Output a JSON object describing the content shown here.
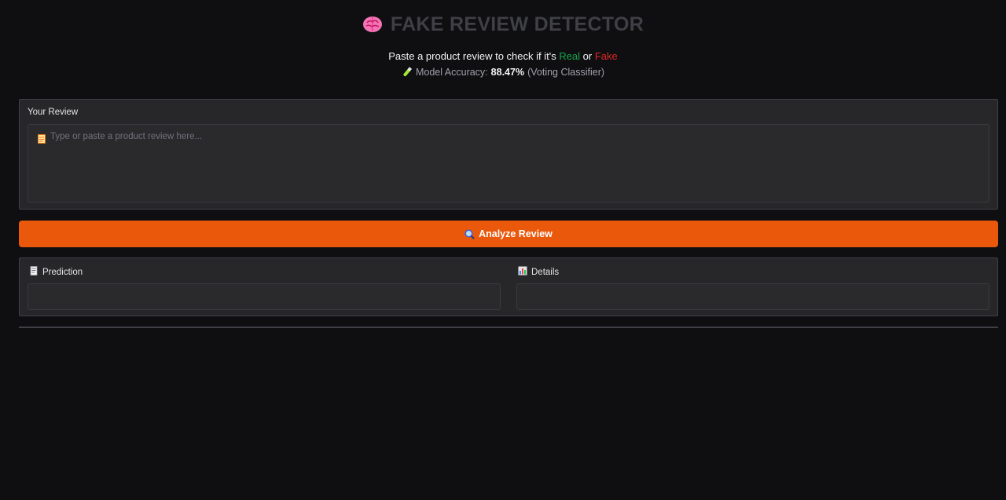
{
  "header": {
    "title": "FAKE REVIEW DETECTOR",
    "icon": "brain-icon",
    "subtitle_prefix": "Paste a product review to check if it's ",
    "real_word": "Real",
    "or_word": " or ",
    "fake_word": "Fake",
    "accuracy_label": "Model Accuracy:",
    "accuracy_value": "88.47%",
    "accuracy_note": "(Voting Classifier)",
    "accuracy_icon": "test-tube-icon"
  },
  "review": {
    "label": "Your Review",
    "placeholder": "Type or paste a product review here...",
    "value": "",
    "icon": "memo-icon"
  },
  "analyze_button": {
    "label": "Analyze Review",
    "icon": "magnifying-glass-icon"
  },
  "output": {
    "prediction_label": "Prediction",
    "prediction_icon": "receipt-icon",
    "prediction_value": "",
    "details_label": "Details",
    "details_icon": "bar-chart-icon",
    "details_value": ""
  },
  "colors": {
    "accent": "#ea580c",
    "real": "#16a34a",
    "fake": "#dc2626",
    "background": "#0f0f11",
    "panel": "#27272a"
  }
}
